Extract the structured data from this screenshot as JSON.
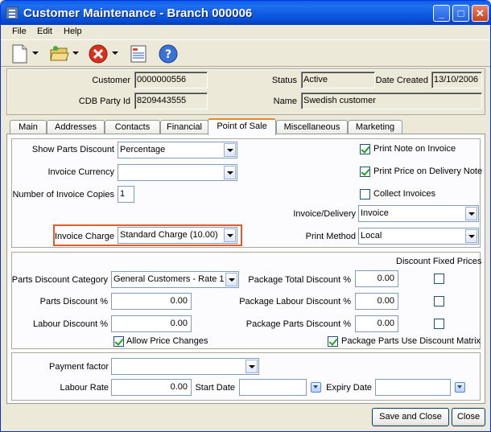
{
  "window": {
    "title": "Customer Maintenance - Branch 000006",
    "minimize": "_",
    "maximize": "□",
    "close": "✕"
  },
  "menu": {
    "file": "File",
    "edit": "Edit",
    "help": "Help"
  },
  "toolbar": {
    "icons": [
      "new-document-icon",
      "open-folder-icon",
      "delete-icon",
      "report-icon",
      "help-icon"
    ]
  },
  "header": {
    "customer_label": "Customer",
    "customer_value": "0000000556",
    "cdb_label": "CDB Party Id",
    "cdb_value": "8209443555",
    "status_label": "Status",
    "status_value": "Active",
    "date_created_label": "Date Created",
    "date_created_value": "13/10/2006",
    "name_label": "Name",
    "name_value": "Swedish customer"
  },
  "tabs": [
    "Main",
    "Addresses",
    "Contacts",
    "Financial",
    "Point of Sale",
    "Miscellaneous",
    "Marketing"
  ],
  "active_tab": "Point of Sale",
  "pos": {
    "show_parts_discount_label": "Show Parts Discount",
    "show_parts_discount_value": "Percentage",
    "invoice_currency_label": "Invoice Currency",
    "invoice_currency_value": "",
    "num_invoice_copies_label": "Number of Invoice Copies",
    "num_invoice_copies_value": "1",
    "invoice_charge_label": "Invoice Charge",
    "invoice_charge_value": "Standard Charge (10.00)",
    "print_note_label": "Print Note on Invoice",
    "print_note_checked": true,
    "print_price_label": "Print Price on Delivery Note",
    "print_price_checked": true,
    "collect_invoices_label": "Collect Invoices",
    "collect_invoices_checked": false,
    "invoice_delivery_label": "Invoice/Delivery",
    "invoice_delivery_value": "Invoice",
    "print_method_label": "Print Method",
    "print_method_value": "Local"
  },
  "discounts": {
    "fixed_prices_header": "Discount Fixed Prices",
    "category_label": "Parts Discount Category",
    "category_value": "General Customers - Rate 1",
    "parts_discount_label": "Parts Discount %",
    "parts_discount_value": "0.00",
    "labour_discount_label": "Labour Discount %",
    "labour_discount_value": "0.00",
    "allow_price_changes_label": "Allow Price Changes",
    "allow_price_changes_checked": true,
    "pkg_total_label": "Package Total Discount %",
    "pkg_total_value": "0.00",
    "pkg_labour_label": "Package Labour Discount %",
    "pkg_labour_value": "0.00",
    "pkg_parts_label": "Package Parts Discount %",
    "pkg_parts_value": "0.00",
    "pkg_use_matrix_label": "Package Parts Use Discount Matrix",
    "pkg_use_matrix_checked": true
  },
  "payment": {
    "payment_factor_label": "Payment factor",
    "payment_factor_value": "",
    "labour_rate_label": "Labour Rate",
    "labour_rate_value": "0.00",
    "start_date_label": "Start Date",
    "start_date_value": "",
    "expiry_date_label": "Expiry Date",
    "expiry_date_value": ""
  },
  "buttons": {
    "save_close": "Save and Close",
    "close": "Close"
  },
  "colors": {
    "title_bar": "#0a5fe8",
    "highlight": "#e35b2a",
    "active_tab": "#e68b2c"
  }
}
